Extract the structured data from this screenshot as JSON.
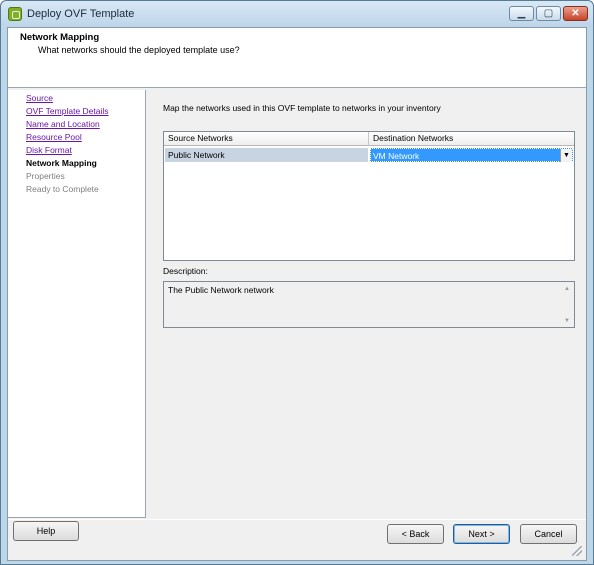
{
  "window": {
    "title": "Deploy OVF Template",
    "app_icon": "vsphere-icon",
    "controls": {
      "minimize": "minimize-icon",
      "maximize": "maximize-icon",
      "close": "close-icon"
    }
  },
  "header": {
    "title": "Network Mapping",
    "subtitle": "What networks should the deployed template use?"
  },
  "sidebar": {
    "steps": [
      {
        "label": "Source",
        "state": "link"
      },
      {
        "label": "OVF Template Details",
        "state": "link"
      },
      {
        "label": "Name and Location",
        "state": "link"
      },
      {
        "label": "Resource Pool",
        "state": "link"
      },
      {
        "label": "Disk Format",
        "state": "link"
      },
      {
        "label": "Network Mapping",
        "state": "current"
      },
      {
        "label": "Properties",
        "state": "disabled"
      },
      {
        "label": "Ready to Complete",
        "state": "disabled"
      }
    ]
  },
  "main": {
    "instruction": "Map the networks used in this OVF template to networks in your inventory",
    "grid": {
      "columns": [
        "Source Networks",
        "Destination Networks"
      ],
      "rows": [
        {
          "source": "Public Network",
          "destination": "VM Network"
        }
      ]
    },
    "description_label": "Description:",
    "description_text": "The Public Network network"
  },
  "footer": {
    "help_label": "Help",
    "back_label": "< Back",
    "next_label": "Next >",
    "cancel_label": "Cancel"
  },
  "colors": {
    "link": "#6a16a8",
    "selection": "#3399ff",
    "source_row": "#c9d4e2",
    "window_frame": "#bcd6ea",
    "close_button": "#c8442a"
  }
}
